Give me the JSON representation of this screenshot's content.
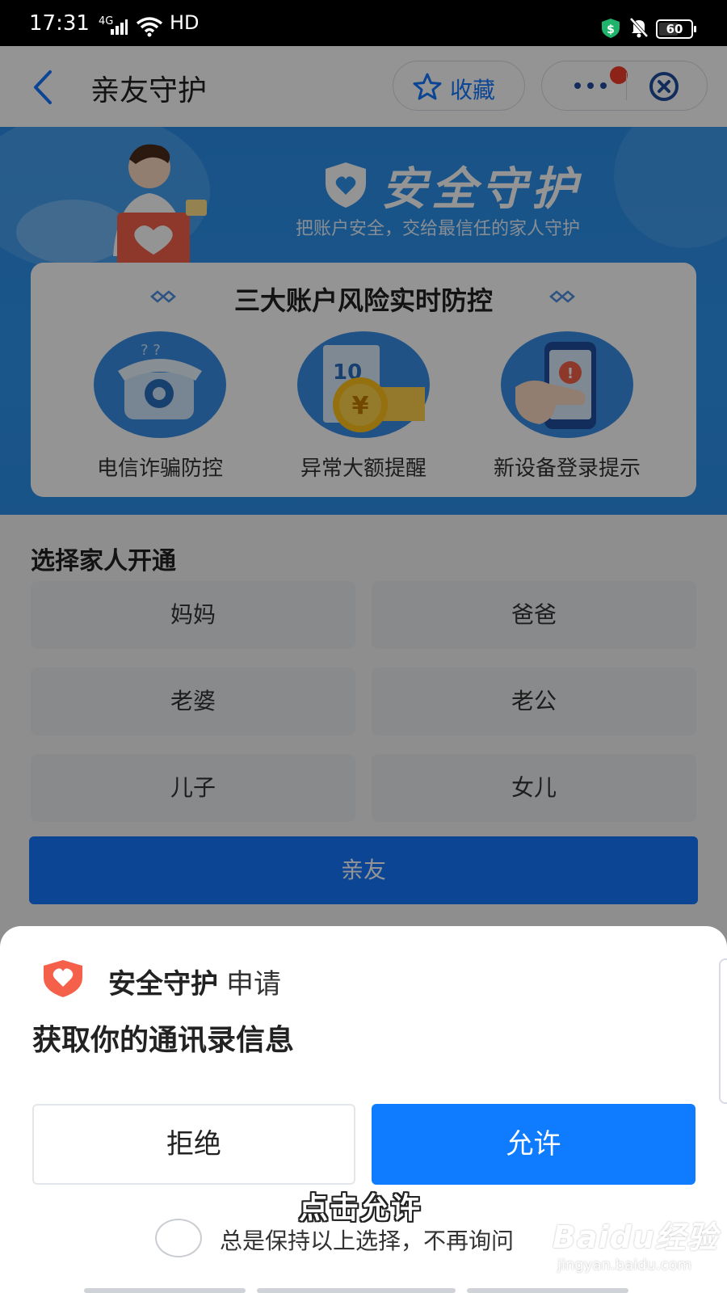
{
  "status_bar": {
    "time": "17:31",
    "network": "4G",
    "hd": "HD",
    "battery": "60",
    "battery_level": 0.6
  },
  "nav": {
    "title": "亲友守护",
    "favorite_label": "收藏"
  },
  "banner": {
    "title": "安全守护",
    "subtitle": "把账户安全，交给最信任的家人守护"
  },
  "risk": {
    "title": "三大账户风险实时防控",
    "features": [
      {
        "label": "电信诈骗防控",
        "icon": "telephone-icon"
      },
      {
        "label": "异常大额提醒",
        "icon": "yuan-coin-icon"
      },
      {
        "label": "新设备登录提示",
        "icon": "phone-alert-icon"
      }
    ]
  },
  "family": {
    "title": "选择家人开通",
    "options": [
      "妈妈",
      "爸爸",
      "老婆",
      "老公",
      "儿子",
      "女儿"
    ],
    "cta_label": "亲友"
  },
  "permission": {
    "app_name": "安全守护",
    "verb": "申请",
    "request": "获取你的通讯录信息",
    "deny_label": "拒绝",
    "allow_label": "允许",
    "remember_label": "总是保持以上选择，不再询问"
  },
  "overlay": {
    "caption": "点击允许",
    "watermark_main": "Baidu经验",
    "watermark_sub": "jingyan.baidu.com"
  },
  "colors": {
    "accent": "#1677ff",
    "banner": "#2f95ee",
    "shield": "#f4604a"
  }
}
